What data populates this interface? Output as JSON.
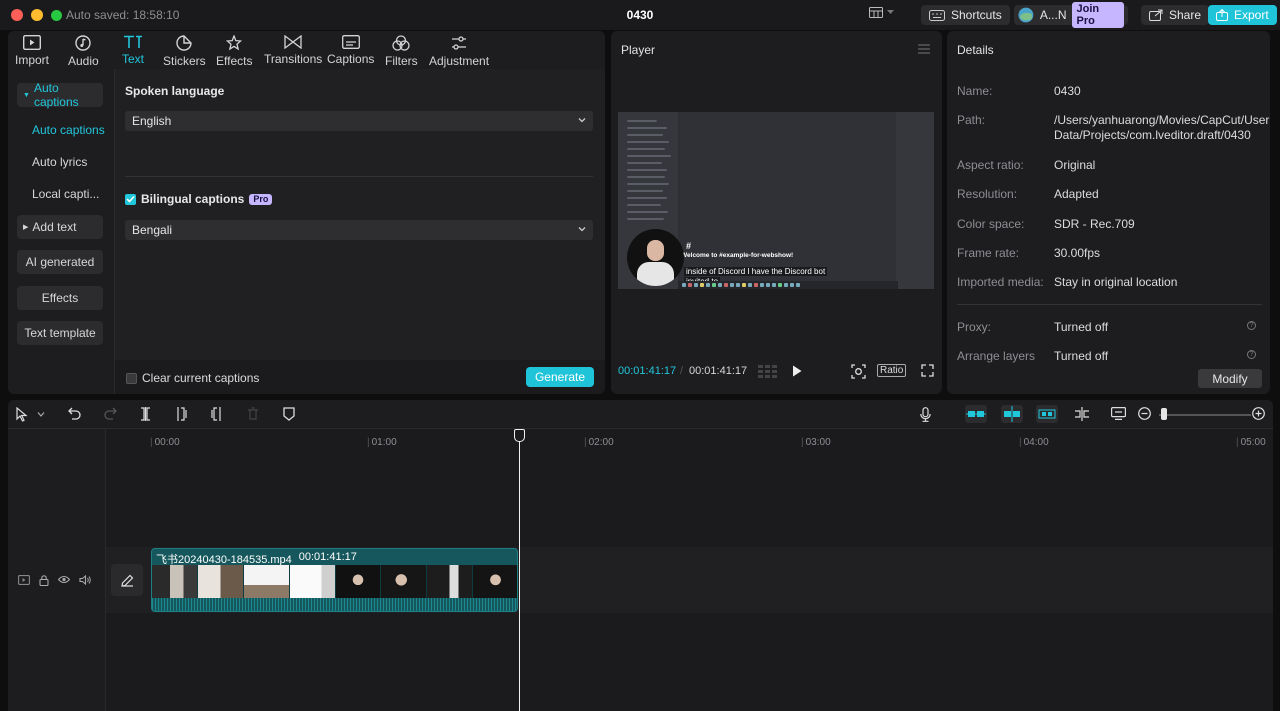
{
  "window": {
    "autosave": "Auto saved: 18:58:10",
    "title": "0430",
    "shortcuts_label": "Shortcuts",
    "account_label": "A...N",
    "join_pro_label": "Join Pro",
    "share_label": "Share",
    "export_label": "Export"
  },
  "toolbar": {
    "tools": [
      {
        "label": "Import",
        "icon": "import-icon"
      },
      {
        "label": "Audio",
        "icon": "audio-icon"
      },
      {
        "label": "Text",
        "icon": "text-icon",
        "active": true
      },
      {
        "label": "Stickers",
        "icon": "stickers-icon"
      },
      {
        "label": "Effects",
        "icon": "effects-icon"
      },
      {
        "label": "Transitions",
        "icon": "transitions-icon"
      },
      {
        "label": "Captions",
        "icon": "captions-icon"
      },
      {
        "label": "Filters",
        "icon": "filters-icon"
      },
      {
        "label": "Adjustment",
        "icon": "adjustment-icon"
      }
    ]
  },
  "sidenav": {
    "auto_captions_group": "Auto captions",
    "auto_captions_item": "Auto captions",
    "auto_lyrics": "Auto lyrics",
    "local_captions": "Local capti...",
    "add_text": "Add text",
    "ai_generated": "AI generated",
    "effects": "Effects",
    "text_template": "Text template"
  },
  "captions": {
    "spoken_language_label": "Spoken language",
    "spoken_language_value": "English",
    "bilingual_label": "Bilingual captions",
    "pro_badge": "Pro",
    "bilingual_checked": true,
    "second_language_value": "Bengali",
    "clear_label": "Clear current captions",
    "clear_checked": false,
    "generate_label": "Generate"
  },
  "player": {
    "title": "Player",
    "video_heading": "Welcome to #example-for-webshow!",
    "video_hash": "#",
    "subtitle_line1": "inside of Discord I have the Discord bot",
    "subtitle_line2": "invited to",
    "current_time": "00:01:41:17",
    "total_time": "00:01:41:17",
    "ratio_label": "Ratio"
  },
  "details": {
    "title": "Details",
    "rows": [
      {
        "key": "Name:",
        "value": "0430"
      },
      {
        "key": "Path:",
        "value": "/Users/yanhuarong/Movies/CapCut/User Data/Projects/com.lveditor.draft/0430"
      },
      {
        "key": "Aspect ratio:",
        "value": "Original"
      },
      {
        "key": "Resolution:",
        "value": "Adapted"
      },
      {
        "key": "Color space:",
        "value": "SDR - Rec.709"
      },
      {
        "key": "Frame rate:",
        "value": "30.00fps"
      },
      {
        "key": "Imported media:",
        "value": "Stay in original location"
      },
      {
        "key": "Proxy:",
        "value": "Turned off"
      },
      {
        "key": "Arrange layers",
        "value": "Turned off"
      }
    ],
    "modify_label": "Modify"
  },
  "timeline": {
    "ticks": [
      "00:00",
      "01:00",
      "02:00",
      "03:00",
      "04:00",
      "05:00"
    ],
    "clip_name": "飞书20240430-184535.mp4",
    "clip_duration": "00:01:41:17"
  },
  "colors": {
    "accent": "#1fc4d9",
    "pro": "#c6b6ff",
    "clip": "#15575c"
  }
}
